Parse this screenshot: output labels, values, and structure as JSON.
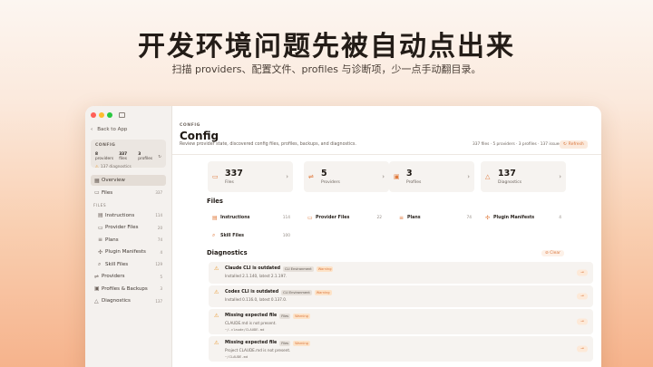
{
  "headline": "开发环境问题先被自动点出来",
  "subline": "扫描 providers、配置文件、profiles 与诊断项，少一点手动翻目录。",
  "sidebar": {
    "back_label": "Back to App",
    "context": {
      "title": "CONFIG",
      "providers_count": "8",
      "providers_label": "providers",
      "files_count": "337",
      "files_label": "files",
      "profiles_count": "3",
      "profiles_label": "profiles",
      "diagnostics": "137 diagnostics"
    },
    "items": [
      {
        "label": "Overview",
        "count": ""
      },
      {
        "label": "Files",
        "count": "337"
      }
    ],
    "files_section": "FILES",
    "file_items": [
      {
        "label": "Instructions",
        "count": "114"
      },
      {
        "label": "Provider Files",
        "count": "20"
      },
      {
        "label": "Plans",
        "count": "74"
      },
      {
        "label": "Plugin Manifests",
        "count": "4"
      },
      {
        "label": "Skill Files",
        "count": "129"
      }
    ],
    "bottom_items": [
      {
        "label": "Providers",
        "count": "5"
      },
      {
        "label": "Profiles & Backups",
        "count": "3"
      },
      {
        "label": "Diagnostics",
        "count": "137"
      }
    ]
  },
  "main": {
    "eyebrow": "CONFIG",
    "title": "Config",
    "description": "Review provider state, discovered config files, profiles, backups, and diagnostics.",
    "summary": "337 files · 5 providers · 3 profiles · 137 issues",
    "refresh_label": "Refresh",
    "stats": [
      {
        "value": "337",
        "label": "Files"
      },
      {
        "value": "5",
        "label": "Providers"
      },
      {
        "value": "3",
        "label": "Profiles"
      },
      {
        "value": "137",
        "label": "Diagnostics"
      }
    ],
    "files_title": "Files",
    "files": [
      {
        "label": "Instructions",
        "count": "114"
      },
      {
        "label": "Provider Files",
        "count": "22"
      },
      {
        "label": "Plans",
        "count": "74"
      },
      {
        "label": "Plugin Manifests",
        "count": "4"
      },
      {
        "label": "Skill Files",
        "count": "100"
      }
    ],
    "diagnostics_title": "Diagnostics",
    "clear_label": "Clear",
    "diagnostics": [
      {
        "title": "Claude CLI is outdated",
        "tag": "CLI Environment",
        "level": "Warning",
        "detail": "Installed 2.1.140, latest 2.1.197.",
        "path": ""
      },
      {
        "title": "Codex CLI is outdated",
        "tag": "CLI Environment",
        "level": "Warning",
        "detail": "Installed 0.116.0, latest 0.137.0.",
        "path": ""
      },
      {
        "title": "Missing expected file",
        "tag": "Files",
        "level": "Warning",
        "detail": "CLAUDE.md is not present.",
        "path": "~/.claude/CLAUDE.md"
      },
      {
        "title": "Missing expected file",
        "tag": "Files",
        "level": "Warning",
        "detail": "Project CLAUDE.md is not present.",
        "path": "~/CLAUDE.md"
      }
    ]
  },
  "colors": {
    "accent": "#e07a3c",
    "warning": "#e8962a"
  }
}
